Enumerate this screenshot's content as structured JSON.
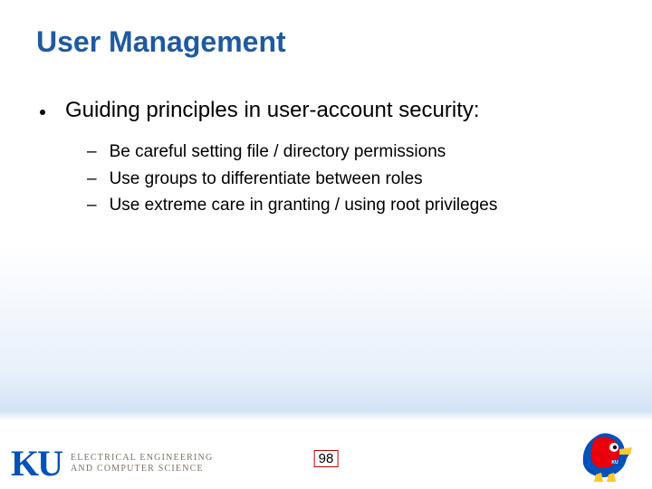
{
  "title": "User Management",
  "main_bullet": "Guiding principles in user-account security:",
  "sub_bullets": [
    "Be careful setting file / directory permissions",
    "Use groups to differentiate between roles",
    "Use extreme care in granting / using root privileges"
  ],
  "footer": {
    "ku": "KU",
    "dept_line1": "ELECTRICAL ENGINEERING",
    "dept_line2": "AND COMPUTER SCIENCE"
  },
  "page_number": "98"
}
